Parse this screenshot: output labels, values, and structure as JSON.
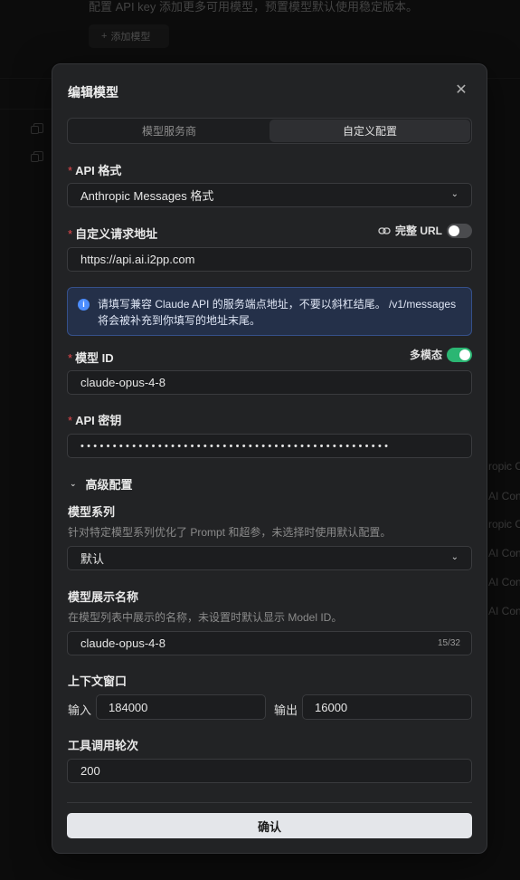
{
  "background": {
    "top_text": "配置 API key 添加更多可用模型，预置模型默认使用稳定版本。",
    "add_model_label": "添加模型",
    "right_texts": [
      "ropic C",
      "AI Con",
      "ropic C",
      "AI Con",
      "AI Con",
      "AI Con"
    ]
  },
  "modal": {
    "title": "编辑模型",
    "tabs": [
      {
        "label": "模型服务商",
        "active": false
      },
      {
        "label": "自定义配置",
        "active": true
      }
    ],
    "api_format": {
      "label": "API 格式",
      "value": "Anthropic Messages 格式"
    },
    "endpoint": {
      "label": "自定义请求地址",
      "full_url_label": "完整 URL",
      "full_url_on": false,
      "value": "https://api.ai.i2pp.com"
    },
    "info": {
      "line1": "请填写兼容 Claude API 的服务端点地址，不要以斜杠结尾。 /v1/messages",
      "line2": "将会被补充到你填写的地址末尾。"
    },
    "model_id": {
      "label": "模型 ID",
      "multimodal_label": "多模态",
      "multimodal_on": true,
      "value": "claude-opus-4-8"
    },
    "api_key": {
      "label": "API 密钥",
      "value": "••••••••••••••••••••••••••••••••••••••••••••••••"
    },
    "advanced": {
      "label": "高级配置",
      "series": {
        "label": "模型系列",
        "hint": "针对特定模型系列优化了 Prompt 和超参，未选择时使用默认配置。",
        "value": "默认"
      },
      "display_name": {
        "label": "模型展示名称",
        "hint": "在模型列表中展示的名称，未设置时默认显示 Model ID。",
        "value": "claude-opus-4-8",
        "counter": "15/32"
      },
      "context_window": {
        "label": "上下文窗口",
        "input_label": "输入",
        "input_value": "184000",
        "output_label": "输出",
        "output_value": "16000"
      },
      "tool_rounds": {
        "label": "工具调用轮次",
        "value": "200"
      }
    },
    "confirm_label": "确认"
  },
  "colors": {
    "accent_toggle": "#2bb673",
    "info_bg": "#243049",
    "required": "#e5484d"
  }
}
